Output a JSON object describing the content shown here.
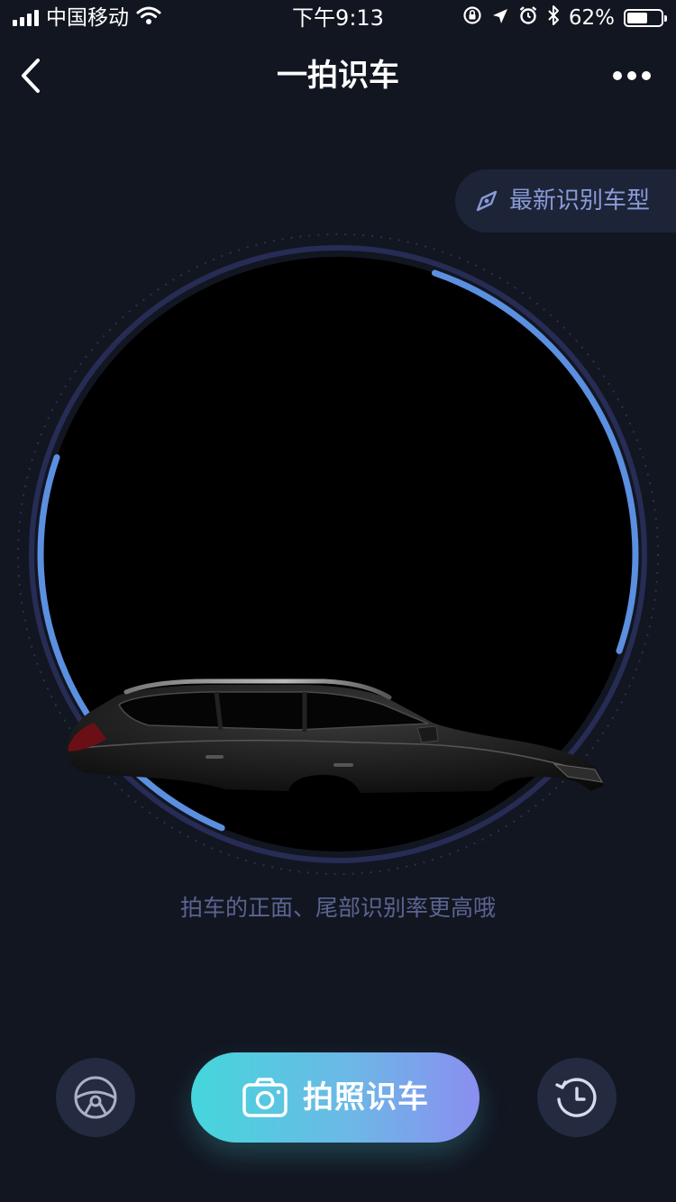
{
  "status_bar": {
    "carrier": "中国移动",
    "time": "下午9:13",
    "battery_percent": "62%",
    "battery_level": 0.62,
    "icons": [
      "signal-icon",
      "wifi-icon",
      "orientation-lock-icon",
      "location-icon",
      "alarm-icon",
      "bluetooth-icon",
      "battery-icon"
    ]
  },
  "nav": {
    "title": "一拍识车",
    "back_icon": "chevron-left-icon",
    "more_icon": "more-dots-icon"
  },
  "latest_chip": {
    "label": "最新识别车型",
    "icon": "compass-icon"
  },
  "camera": {
    "hint": "拍车的正面、尾部识别率更高哦",
    "accent_color": "#5b8fe0",
    "ring_color": "#2a2f5a"
  },
  "controls": {
    "steering_icon": "steering-wheel-icon",
    "capture_label": "拍照识车",
    "capture_icon": "camera-icon",
    "history_icon": "history-clock-icon"
  },
  "colors": {
    "background": "#121621",
    "hint": "#5b6491",
    "chip_text": "#8a9bd6",
    "button_gradient_start": "#45d6dc",
    "button_gradient_end": "#8a8ef0"
  }
}
